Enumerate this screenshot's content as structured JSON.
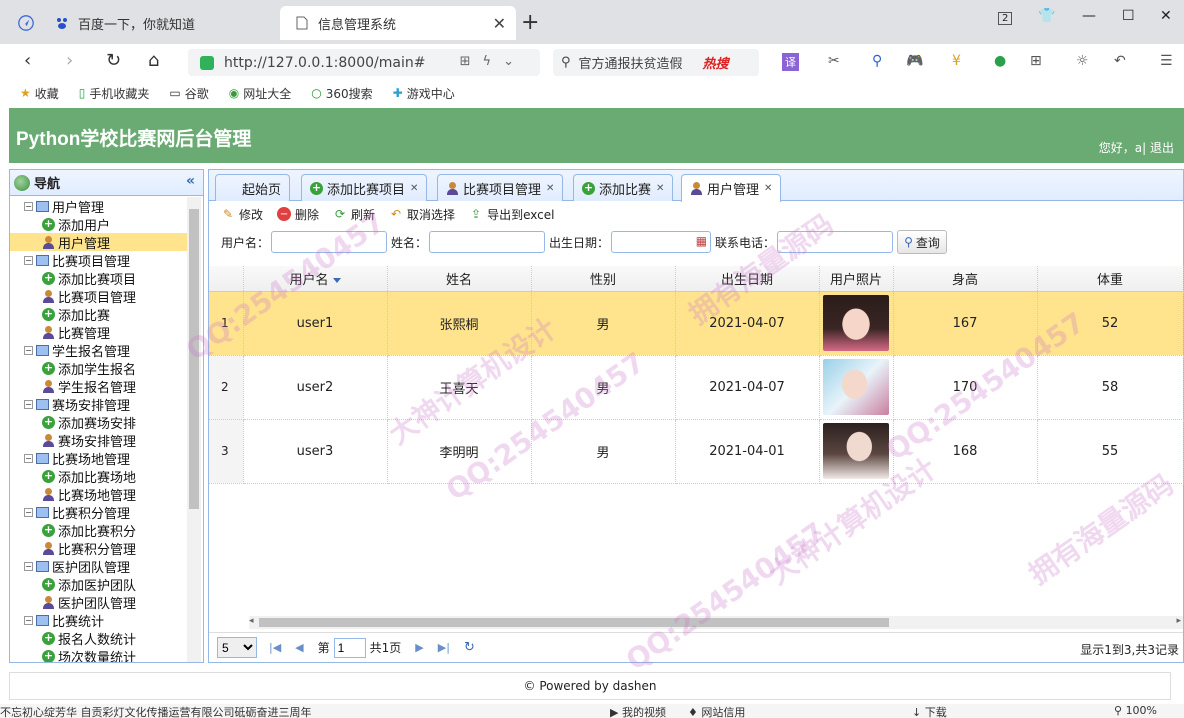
{
  "browser": {
    "tabs": [
      {
        "label": "百度一下，你就知道"
      },
      {
        "label": "信息管理系统"
      }
    ],
    "url": "http://127.0.0.1:8000/main#",
    "search_text": "官方通报扶贫造假",
    "search_badge": "热搜",
    "tab_count": "2",
    "bookmarks": [
      "收藏",
      "手机收藏夹",
      "谷歌",
      "网址大全",
      "360搜索",
      "游戏中心"
    ]
  },
  "app": {
    "title": "Python学校比赛网后台管理",
    "greeting": "您好，a| 退出"
  },
  "sidebar": {
    "title": "导航",
    "tree": [
      {
        "label": "用户管理",
        "type": "group"
      },
      {
        "label": "添加用户",
        "type": "add"
      },
      {
        "label": "用户管理",
        "type": "user",
        "selected": true
      },
      {
        "label": "比赛项目管理",
        "type": "group"
      },
      {
        "label": "添加比赛项目",
        "type": "add"
      },
      {
        "label": "比赛项目管理",
        "type": "user"
      },
      {
        "label": "添加比赛",
        "type": "add"
      },
      {
        "label": "比赛管理",
        "type": "user"
      },
      {
        "label": "学生报名管理",
        "type": "group"
      },
      {
        "label": "添加学生报名",
        "type": "add"
      },
      {
        "label": "学生报名管理",
        "type": "user"
      },
      {
        "label": "赛场安排管理",
        "type": "group"
      },
      {
        "label": "添加赛场安排",
        "type": "add"
      },
      {
        "label": "赛场安排管理",
        "type": "user"
      },
      {
        "label": "比赛场地管理",
        "type": "group"
      },
      {
        "label": "添加比赛场地",
        "type": "add"
      },
      {
        "label": "比赛场地管理",
        "type": "user"
      },
      {
        "label": "比赛积分管理",
        "type": "group"
      },
      {
        "label": "添加比赛积分",
        "type": "add"
      },
      {
        "label": "比赛积分管理",
        "type": "user"
      },
      {
        "label": "医护团队管理",
        "type": "group"
      },
      {
        "label": "添加医护团队",
        "type": "add"
      },
      {
        "label": "医护团队管理",
        "type": "user"
      },
      {
        "label": "比赛统计",
        "type": "group"
      },
      {
        "label": "报名人数统计",
        "type": "add"
      },
      {
        "label": "场次数量统计",
        "type": "add"
      }
    ]
  },
  "panel_tabs": [
    {
      "label": "起始页",
      "closable": false,
      "icon": "none"
    },
    {
      "label": "添加比赛项目",
      "closable": true,
      "icon": "add"
    },
    {
      "label": "比赛项目管理",
      "closable": true,
      "icon": "user"
    },
    {
      "label": "添加比赛",
      "closable": true,
      "icon": "add"
    },
    {
      "label": "用户管理",
      "closable": true,
      "icon": "user",
      "active": true
    }
  ],
  "toolbar": {
    "edit": "修改",
    "delete": "删除",
    "refresh": "刷新",
    "deselect": "取消选择",
    "export": "导出到excel"
  },
  "filters": {
    "username_label": "用户名：",
    "name_label": "姓名：",
    "birth_label": "出生日期：",
    "phone_label": "联系电话：",
    "query_label": "查询"
  },
  "grid": {
    "columns": [
      "用户名",
      "姓名",
      "性别",
      "出生日期",
      "用户照片",
      "身高",
      "体重"
    ],
    "rows": [
      {
        "num": "1",
        "user": "user1",
        "name": "张熙桐",
        "sex": "男",
        "birth": "2021-04-07",
        "height": "167",
        "weight": "52"
      },
      {
        "num": "2",
        "user": "user2",
        "name": "王喜天",
        "sex": "男",
        "birth": "2021-04-07",
        "height": "170",
        "weight": "58"
      },
      {
        "num": "3",
        "user": "user3",
        "name": "李明明",
        "sex": "男",
        "birth": "2021-04-01",
        "height": "168",
        "weight": "55"
      }
    ]
  },
  "pager": {
    "page_size": "5",
    "page_prefix": "第",
    "page_value": "1",
    "page_total": "共1页",
    "info": "显示1到3,共3记录"
  },
  "footer": "© Powered by dashen",
  "statusbar": {
    "left": "不忘初心绽芳华 自贡彩灯文化传播运营有限公司砥砺奋进三周年",
    "video": "我的视频",
    "net": "网站信用",
    "download": "下载",
    "zoom": "100%"
  },
  "watermark": {
    "qq": "QQ:254540457",
    "t1": "大神计算机设计",
    "t2": "拥有海量源码"
  },
  "colors": {
    "header_green": "#6aab74",
    "selected_row": "#ffe48d",
    "panel_border": "#95b8e7"
  }
}
